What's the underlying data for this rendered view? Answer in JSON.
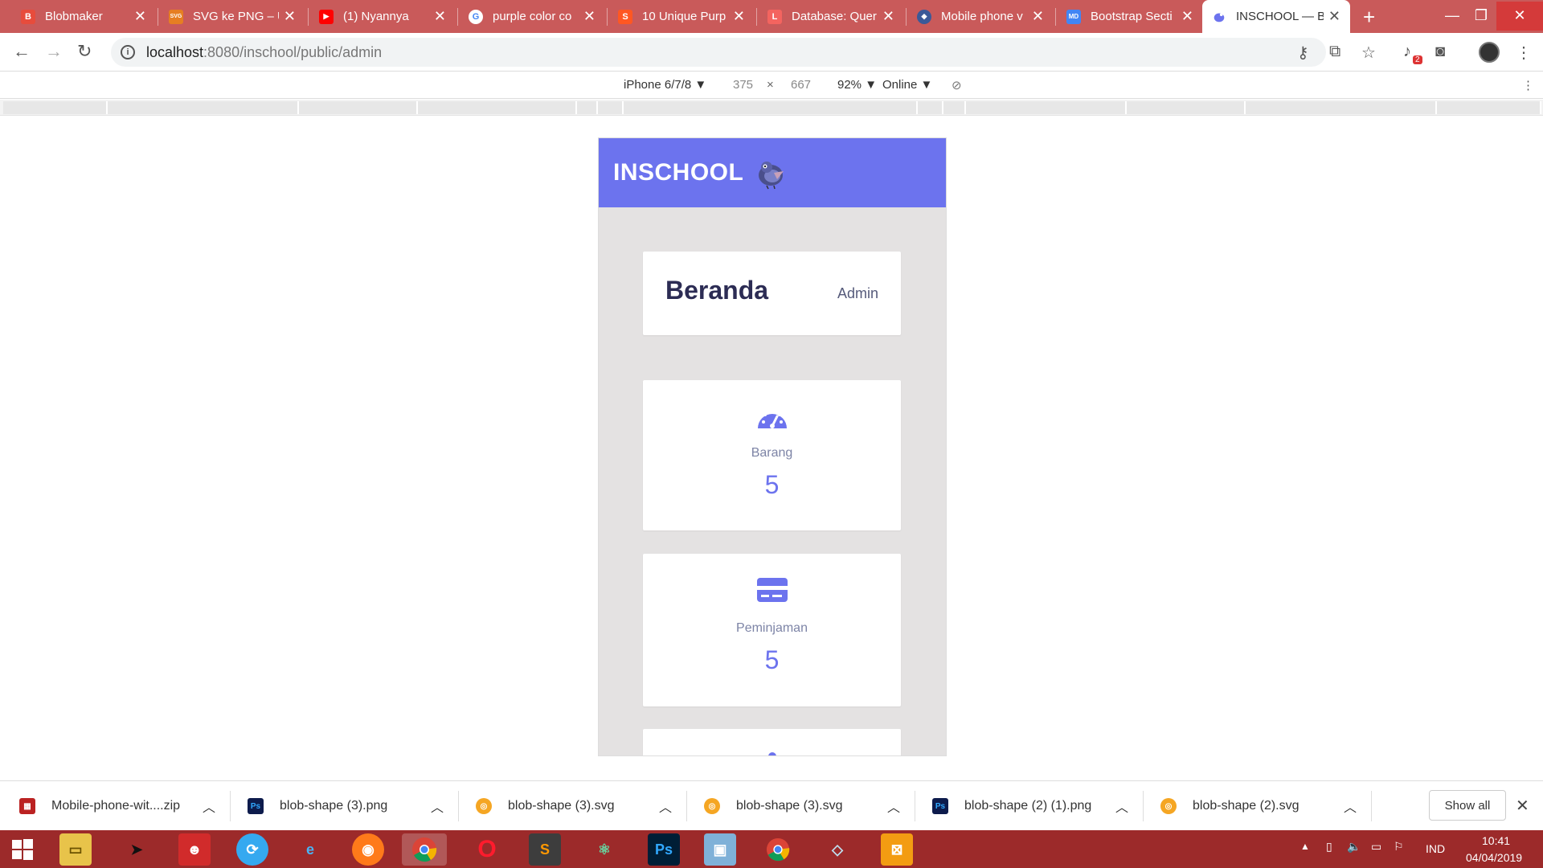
{
  "browser": {
    "tabs": [
      {
        "title": "Blobmaker",
        "favicon": "B",
        "color": "#e74c3c"
      },
      {
        "title": "SVG ke PNG – U",
        "favicon": "SVG",
        "color": "#e67e22"
      },
      {
        "title": "(1) Nyannya",
        "favicon": "▶",
        "color": "#ff0000"
      },
      {
        "title": "purple color co",
        "favicon": "G",
        "color": "#4285f4"
      },
      {
        "title": "10 Unique Purp",
        "favicon": "S",
        "color": "#ff5722"
      },
      {
        "title": "Database: Quer",
        "favicon": "L",
        "color": "#f4645f"
      },
      {
        "title": "Mobile phone v",
        "favicon": "◆",
        "color": "#3b5998"
      },
      {
        "title": "Bootstrap Secti",
        "favicon": "MD",
        "color": "#4285f4"
      },
      {
        "title": "INSCHOOL — B",
        "favicon": "🐦",
        "color": "#6c73ee"
      }
    ],
    "new_tab": "+",
    "url_host": "localhost",
    "url_path": ":8080/inschool/public/admin"
  },
  "devtools": {
    "device": "iPhone 6/7/8 ▼",
    "width": "375",
    "x": "×",
    "height": "667",
    "zoom": "92% ▼",
    "network": "Online ▼"
  },
  "app": {
    "brand": "INSCHOOL",
    "page_title": "Beranda",
    "role": "Admin",
    "stats": [
      {
        "label": "Barang",
        "value": "5",
        "icon": "gauge-icon"
      },
      {
        "label": "Peminjaman",
        "value": "5",
        "icon": "credit-card-icon"
      }
    ],
    "accent": "#6c73ee"
  },
  "downloads": [
    {
      "name": "Mobile-phone-wit....zip",
      "icon": "zip-icon"
    },
    {
      "name": "blob-shape (3).png",
      "icon": "photoshop-icon"
    },
    {
      "name": "blob-shape (3).svg",
      "icon": "chrome-file-icon"
    },
    {
      "name": "blob-shape (3).svg",
      "icon": "chrome-file-icon"
    },
    {
      "name": "blob-shape (2) (1).png",
      "icon": "photoshop-icon"
    },
    {
      "name": "blob-shape (2).svg",
      "icon": "chrome-file-icon"
    }
  ],
  "show_all": "Show all",
  "taskbar": {
    "lang": "IND",
    "time": "10:41",
    "date": "04/04/2019"
  }
}
